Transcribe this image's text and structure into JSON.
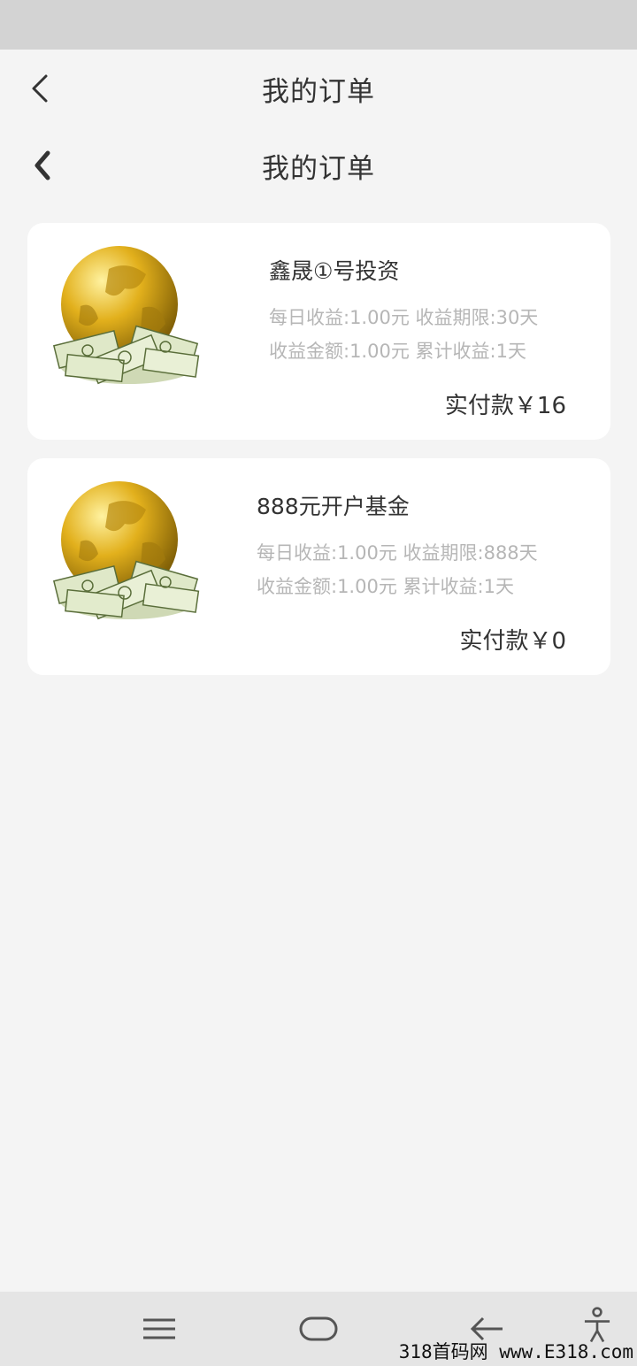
{
  "header": {
    "title": "我的订单"
  },
  "subheader": {
    "title": "我的订单"
  },
  "orders": [
    {
      "name": "鑫晟①号投资",
      "line1": "每日收益:1.00元 收益期限:30天",
      "line2": "收益金额:1.00元 累计收益:1天",
      "price": "实付款￥16"
    },
    {
      "name": "888元开户基金",
      "line1": "每日收益:1.00元 收益期限:888天",
      "line2": "收益金额:1.00元 累计收益:1天",
      "price": "实付款￥0"
    }
  ],
  "watermark": "318首码网 www.E318.com",
  "icons": [
    "back-arrow-icon",
    "globe-money-icon",
    "menu-icon",
    "home-icon",
    "back-icon",
    "accessibility-icon"
  ]
}
